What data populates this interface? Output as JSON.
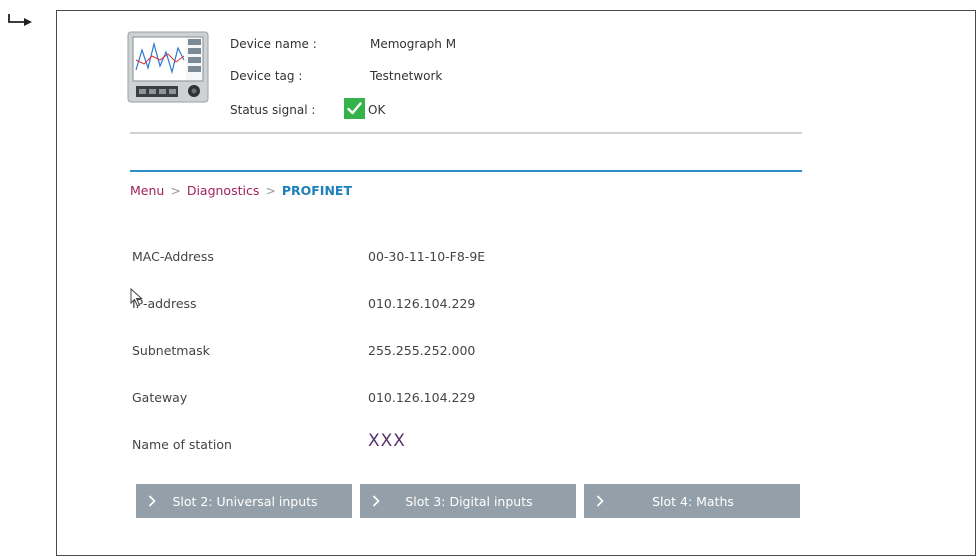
{
  "device": {
    "name_label": "Device name :",
    "name_value": "Memograph M",
    "tag_label": "Device tag :",
    "tag_value": "Testnetwork",
    "status_label": "Status signal :",
    "status_value": "OK",
    "status_icon": "check-icon",
    "status_color": "#35b34a"
  },
  "breadcrumb": {
    "items": [
      "Menu",
      "Diagnostics"
    ],
    "separator": ">",
    "current": "PROFINET"
  },
  "rows": [
    {
      "label": "MAC-Address",
      "value": "00-30-11-10-F8-9E"
    },
    {
      "label": "IP-address",
      "value": "010.126.104.229"
    },
    {
      "label": "Subnetmask",
      "value": "255.255.252.000"
    },
    {
      "label": "Gateway",
      "value": "010.126.104.229"
    },
    {
      "label": "Name of station",
      "value": "XXX"
    }
  ],
  "slots": [
    {
      "label": "Slot 2: Universal inputs"
    },
    {
      "label": "Slot 3: Digital inputs"
    },
    {
      "label": "Slot 4: Maths"
    }
  ],
  "colors": {
    "accent_blue": "#2b8fc9",
    "breadcrumb_link": "#a3225b",
    "button_bg": "#93a0a9"
  }
}
